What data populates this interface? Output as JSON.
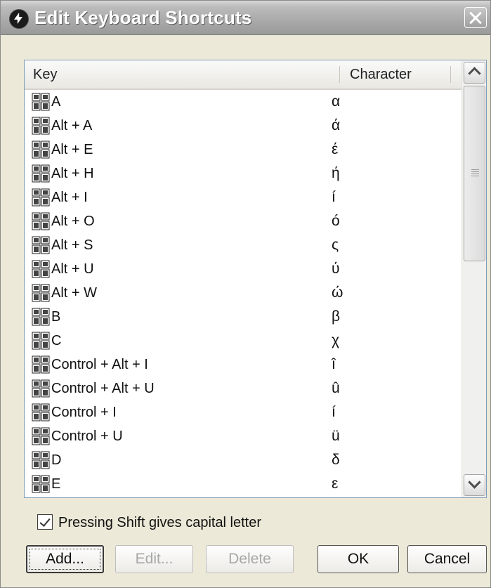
{
  "window": {
    "title": "Edit Keyboard Shortcuts"
  },
  "list": {
    "columns": {
      "key": "Key",
      "character": "Character"
    },
    "rows": [
      {
        "key": "A",
        "char": "α"
      },
      {
        "key": "Alt + A",
        "char": "ά"
      },
      {
        "key": "Alt + E",
        "char": "έ"
      },
      {
        "key": "Alt + H",
        "char": "ή"
      },
      {
        "key": "Alt + I",
        "char": "í"
      },
      {
        "key": "Alt + O",
        "char": "ó"
      },
      {
        "key": "Alt + S",
        "char": "ς"
      },
      {
        "key": "Alt + U",
        "char": "ύ"
      },
      {
        "key": "Alt + W",
        "char": "ώ"
      },
      {
        "key": "B",
        "char": "β"
      },
      {
        "key": "C",
        "char": "χ"
      },
      {
        "key": "Control + Alt + I",
        "char": "î"
      },
      {
        "key": "Control + Alt + U",
        "char": "û"
      },
      {
        "key": "Control + I",
        "char": "í"
      },
      {
        "key": "Control + U",
        "char": "ü"
      },
      {
        "key": "D",
        "char": "δ"
      },
      {
        "key": "E",
        "char": "ε"
      }
    ],
    "scroll_position": 0
  },
  "options": {
    "shift_checkbox_label": "Pressing Shift gives capital letter",
    "shift_checked": true
  },
  "buttons": {
    "add": "Add...",
    "edit": "Edit...",
    "delete": "Delete",
    "ok": "OK",
    "cancel": "Cancel"
  },
  "icons": {
    "app": "app-logo-icon",
    "row": "keyboard-icon",
    "close": "close-icon"
  }
}
